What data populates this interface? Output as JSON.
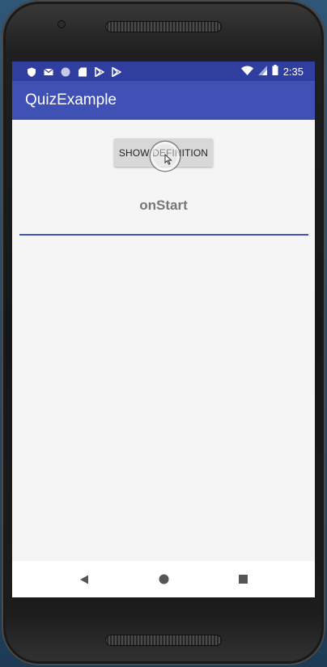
{
  "status_bar": {
    "time": "2:35",
    "left_icons": [
      "shield-icon",
      "mail-icon",
      "circle-icon",
      "sd-card-icon",
      "play-store-icon",
      "play-store-icon"
    ],
    "right_icons": [
      "wifi-icon",
      "cell-signal-icon",
      "battery-icon"
    ]
  },
  "app_bar": {
    "title": "QuizExample"
  },
  "main": {
    "show_button_label": "SHOW DEFINITION",
    "lifecycle_text": "onStart"
  },
  "nav_bar": {
    "icons": [
      "back-icon",
      "home-icon",
      "recents-icon"
    ]
  },
  "colors": {
    "primary": "#3f51b5",
    "primary_dark": "#303f9f",
    "background": "#f5f5f5",
    "button": "#d8d8d8"
  }
}
